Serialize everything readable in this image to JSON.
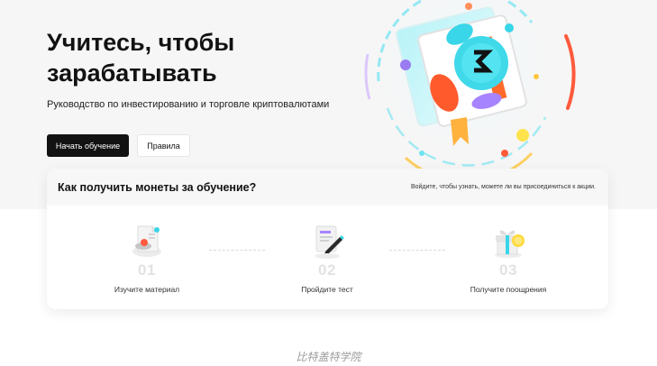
{
  "hero": {
    "title": "Учитесь, чтобы зарабатывать",
    "subtitle": "Руководство по инвестированию и торговле криптовалютами",
    "primary_button": "Начать обучение",
    "secondary_button": "Правила"
  },
  "card": {
    "title": "Как получить монеты за обучение?",
    "note": "Войдите, чтобы узнать, можете ли вы присоединиться к акции.",
    "steps": [
      {
        "number": "01",
        "label": "Изучите материал",
        "icon": "study-material-icon"
      },
      {
        "number": "02",
        "label": "Пройдите тест",
        "icon": "test-document-icon"
      },
      {
        "number": "03",
        "label": "Получите поощрения",
        "icon": "gift-reward-icon"
      }
    ]
  },
  "footer": {
    "text": "比特盖特学院"
  },
  "colors": {
    "primary": "#121212",
    "accent_cyan": "#39d5e8",
    "accent_orange": "#ff6a2c",
    "accent_purple": "#9b7bf2",
    "muted_number": "#e2e2e2"
  }
}
